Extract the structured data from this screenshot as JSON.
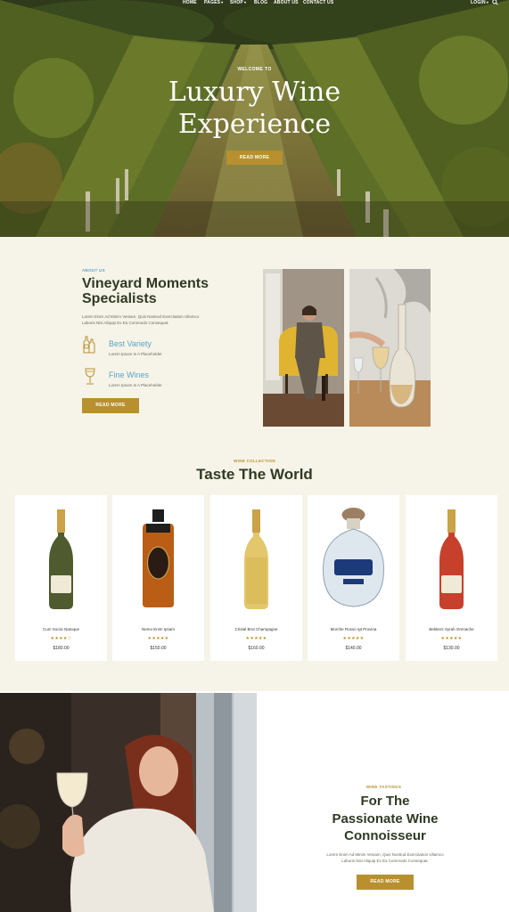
{
  "nav": {
    "items": [
      "HOME",
      "PAGES",
      "SHOP",
      "BLOG",
      "ABOUT US",
      "CONTACT US"
    ],
    "login": "LOGIN",
    "search_icon": "search-icon"
  },
  "hero": {
    "eyebrow": "WELCOME TO",
    "title_line1": "Luxury Wine",
    "title_line2": "Experience",
    "button": "READ MORE"
  },
  "about": {
    "eyebrow": "ABOUT US",
    "title_line1": "Vineyard Moments",
    "title_line2": "Specialists",
    "text_line1": "Lorem Enim Ad Minim Veniam, Quis Nostrud Exercitation Ullamco",
    "text_line2": "Laboris Nisi Aliquip Ex Ea Commodo Consequat.",
    "features": [
      {
        "title": "Best Variety",
        "subtitle": "Lorem Ipsum Is A Placeholder",
        "icon": "wine-bottles-icon"
      },
      {
        "title": "Fine Wines",
        "subtitle": "Lorem Ipsum Is A Placeholder",
        "icon": "wine-glass-icon"
      }
    ],
    "button": "READ MORE"
  },
  "collection": {
    "eyebrow": "WINE COLLECTION",
    "title": "Taste The World",
    "products": [
      {
        "name": "Cum Sociis Natoque",
        "stars": "★★★★☆",
        "price": "$180.00"
      },
      {
        "name": "Nemo Enim Ipsam",
        "stars": "★★★★★",
        "price": "$150.00"
      },
      {
        "name": "Cristal Brut Champagne",
        "stars": "★★★★★",
        "price": "$160.00"
      },
      {
        "name": "Morche Rosso Igt Provina",
        "stars": "★★★★★",
        "price": "$140.00"
      },
      {
        "name": "Bekkers Syrah Grenache",
        "stars": "★★★★★",
        "price": "$130.00"
      }
    ]
  },
  "tastings": {
    "eyebrow": "WINE TASTINGS",
    "title_line1": "For The",
    "title_line2": "Passionate Wine",
    "title_line3": "Connoisseur",
    "text_line1": "Lorem Enim Ad Minim Veniam, Quis Nostrud Exercitation Ullamco",
    "text_line2": "Laboris Nisi Aliquip Ex Ea Commodo Consequat.",
    "button": "READ MORE"
  },
  "colors": {
    "accent": "#b8902f",
    "heading": "#2f3a23",
    "eyebrow_blue": "#5aa4c7",
    "page_bg": "#f6f4e8"
  }
}
